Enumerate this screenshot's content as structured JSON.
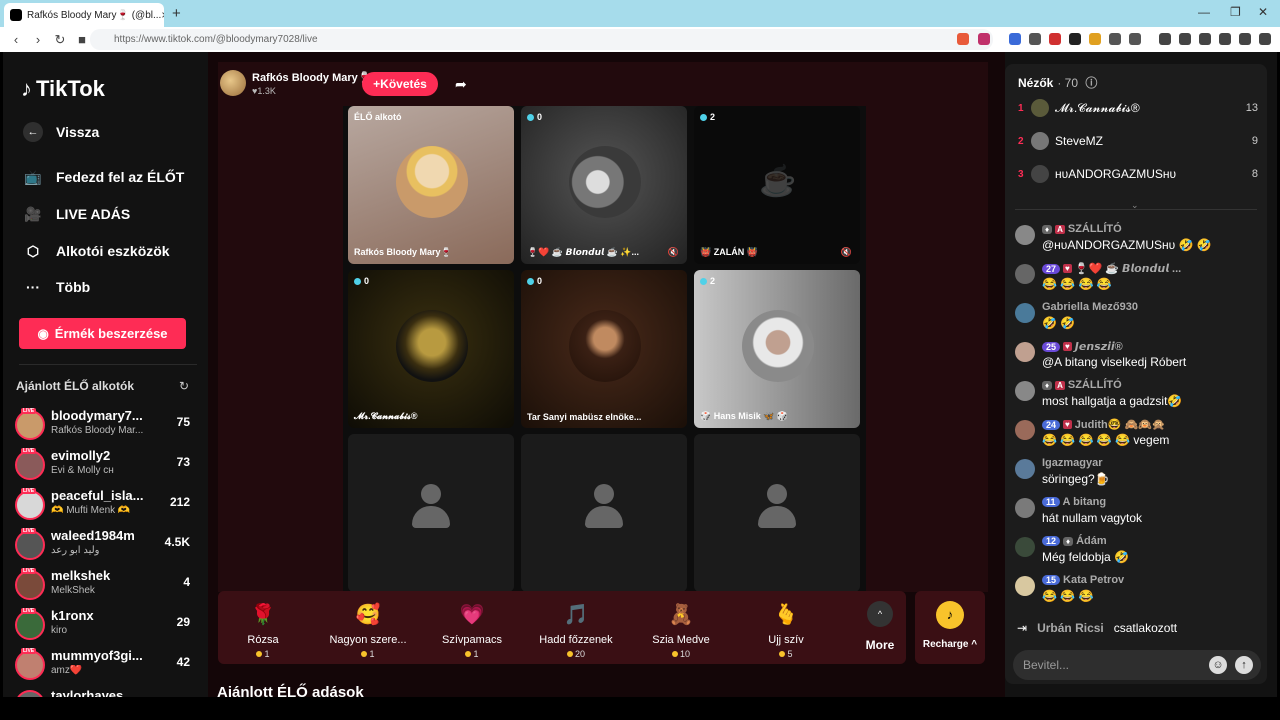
{
  "browser": {
    "tab_title": "Rafkós Bloody Mary🍷 (@bl...",
    "url": "https://www.tiktok.com/@bloodymary7028/live"
  },
  "sidebar": {
    "logo_text": "TikTok",
    "back_label": "Vissza",
    "nav": [
      {
        "label": "Fedezd fel az ÉLŐT",
        "icon": "live-tv-icon"
      },
      {
        "label": "LIVE ADÁS",
        "icon": "camera-icon"
      },
      {
        "label": "Alkotói eszközök",
        "icon": "tools-icon"
      },
      {
        "label": "Több",
        "icon": "more-icon"
      }
    ],
    "coins_button": "Érmék beszerzése",
    "recommended_title": "Ajánlott ÉLŐ alkotók",
    "live_badge": "LIVE",
    "creators": [
      {
        "name": "bloodymary7...",
        "sub": "Rafkós Bloody Mar...",
        "count": "75",
        "color": "#c99a6a"
      },
      {
        "name": "evimolly2",
        "sub": "Évi & Molly ᴄʜ",
        "count": "73",
        "color": "#8a5a5a"
      },
      {
        "name": "peaceful_isla...",
        "sub": "🫶 Mufti Menk 🫶",
        "count": "212",
        "color": "#d8d8d8"
      },
      {
        "name": "waleed1984m",
        "sub": "وليد ابو رعد",
        "count": "4.5K",
        "color": "#555"
      },
      {
        "name": "melkshek",
        "sub": "MelkShek",
        "count": "4",
        "color": "#7a4a3a"
      },
      {
        "name": "k1ronx",
        "sub": "kiro",
        "count": "29",
        "color": "#3a6a3a"
      },
      {
        "name": "mummyof3gi...",
        "sub": "amz❤️",
        "count": "42",
        "color": "#c08070"
      },
      {
        "name": "taylorhayes",
        "sub": "",
        "count": "",
        "color": "#666"
      }
    ]
  },
  "stage": {
    "host_name": "Rafkós Bloody Mary🍷",
    "host_likes": "♥1.3K",
    "follow_label": "+Követés",
    "cells": [
      {
        "badge": "ÉLŐ alkotó",
        "label": "Rafkós Bloody Mary🍷",
        "kind": "host"
      },
      {
        "badge": "0",
        "label": "🍷❤️ ☕ 𝘽𝙡𝙤𝙣𝙙𝙪𝙡 ☕ ✨...",
        "kind": "guest"
      },
      {
        "badge": "2",
        "label": "👹 ZALÁN 👹",
        "kind": "guest"
      },
      {
        "badge": "0",
        "label": "𝓜𝓻.𝓒𝓪𝓷𝓷𝓪𝓫𝓲𝓼®",
        "kind": "guest"
      },
      {
        "badge": "0",
        "label": "Tar Sanyi mabüsz elnöke...",
        "kind": "guest"
      },
      {
        "badge": "2",
        "label": "🎲 Hans Misik 🦋 🎲",
        "kind": "guest"
      }
    ],
    "gifts": [
      {
        "icon": "🌹",
        "name": "Rózsa",
        "price": "1"
      },
      {
        "icon": "🥰",
        "name": "Nagyon szere...",
        "price": "1"
      },
      {
        "icon": "💗",
        "name": "Szívpamacs",
        "price": "1"
      },
      {
        "icon": "🎵",
        "name": "Hadd főzzenek",
        "price": "20"
      },
      {
        "icon": "🧸",
        "name": "Szia Medve",
        "price": "10"
      },
      {
        "icon": "🫰",
        "name": "Ujj szív",
        "price": "5"
      }
    ],
    "more_label": "More",
    "recharge_label": "Recharge ^",
    "recommended_streams": "Ajánlott ÉLŐ adások"
  },
  "chat": {
    "viewers_title": "Nézők",
    "viewers_count": "· 70",
    "viewers": [
      {
        "rank": "1",
        "name": "𝓜𝓻.𝓒𝓪𝓷𝓷𝓪𝓫𝓲𝓼®",
        "score": "13",
        "color": "#5a5a3a"
      },
      {
        "rank": "2",
        "name": "SteveMZ",
        "score": "9",
        "color": "#777"
      },
      {
        "rank": "3",
        "name": "ʜᴜANDORGAZMUSʜᴜ",
        "score": "8",
        "color": "#444"
      }
    ],
    "messages": [
      {
        "who": "SZÁLLÍTÓ",
        "level": "",
        "text": "@ʜᴜANDORGAZMUSʜᴜ 🤣 🤣",
        "color": "#888"
      },
      {
        "who": "🍷❤️ ☕ 𝘽𝙡𝙤𝙣𝙙𝙪𝙡 ...",
        "level": "27",
        "text": "😂 😂 😂 😂",
        "color": "#666"
      },
      {
        "who": "Gabriella Mező930",
        "level": "",
        "text": "🤣 🤣",
        "color": "#4a7a9a"
      },
      {
        "who": "𝙅𝙚𝙣𝙨𝙯𝙞𝙞®",
        "level": "25",
        "text": "@A bitang viselkedj Róbert",
        "color": "#c0a090"
      },
      {
        "who": "SZÁLLÍTÓ",
        "level": "",
        "text": "most hallgatja a gadzsit🤣",
        "color": "#888"
      },
      {
        "who": "Judith🤓 🙈🙉🙊",
        "level": "24",
        "text": "😂 😂 😂 😂 😂 vegem",
        "color": "#9a6a5a"
      },
      {
        "who": "Igazmagyar",
        "level": "",
        "text": "söringeg?🍺",
        "color": "#5a7a9a"
      },
      {
        "who": "A bitang",
        "level": "11",
        "text": "hát nullam vagytok",
        "color": "#7a7a7a"
      },
      {
        "who": "Ádám",
        "level": "12",
        "text": "Még feldobja 🤣",
        "color": "#3a4a3a"
      },
      {
        "who": "Kata Petrov",
        "level": "15",
        "text": "😂 😂 😂",
        "color": "#d8c8a0"
      }
    ],
    "join_name": "Urbán Ricsi",
    "join_text": "csatlakozott",
    "input_placeholder": "Bevitel..."
  }
}
